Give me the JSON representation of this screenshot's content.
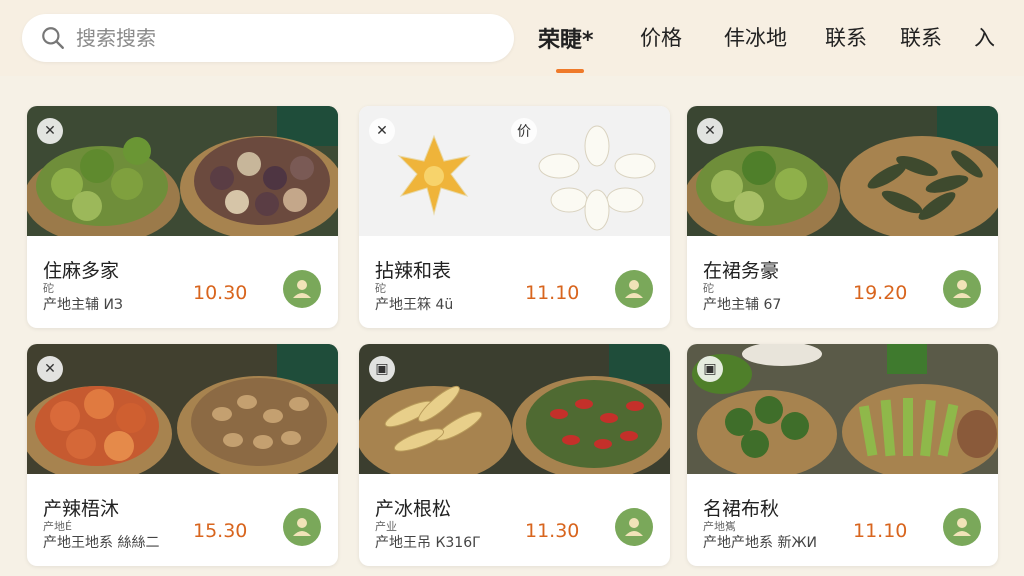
{
  "search": {
    "placeholder": "搜索搜索"
  },
  "tabs": [
    {
      "label": "荣睫*",
      "active": true
    },
    {
      "label": "价格"
    },
    {
      "label": "仹冰地"
    },
    {
      "label": "联系"
    },
    {
      "label": "联系"
    },
    {
      "label": "入"
    }
  ],
  "accent_color": "#ef7a2a",
  "price_color": "#d8651e",
  "avatar_color": "#7aa85a",
  "cards": [
    {
      "title": "住麻多家",
      "sub": "砣",
      "meta": "产地主辅 ИЗ",
      "price": "10.30",
      "corner_icons": [
        "close-icon"
      ]
    },
    {
      "title": "拈辣和表",
      "sub": "砣",
      "meta": "产地王箖 4ü",
      "price": "11.10",
      "corner_icons": [
        "close-icon",
        "price-icon"
      ]
    },
    {
      "title": "在裙务豪",
      "sub": "砣",
      "meta": "产地主辅 67",
      "price": "19.20",
      "corner_icons": [
        "close-icon"
      ]
    },
    {
      "title": "产辣梧沐",
      "sub": "产地É",
      "meta": "产地王地系 絲絲二",
      "price": "15.30",
      "corner_icons": [
        "close-icon"
      ]
    },
    {
      "title": "产冰根松",
      "sub": "产业",
      "meta": "产地王吊 К316Г",
      "price": "11.30",
      "corner_icons": [
        "image-icon"
      ]
    },
    {
      "title": "名裙布秋",
      "sub": "产地嶲",
      "meta": "产地产地系 新ЖИ",
      "price": "11.10",
      "corner_icons": [
        "image-icon"
      ]
    }
  ]
}
